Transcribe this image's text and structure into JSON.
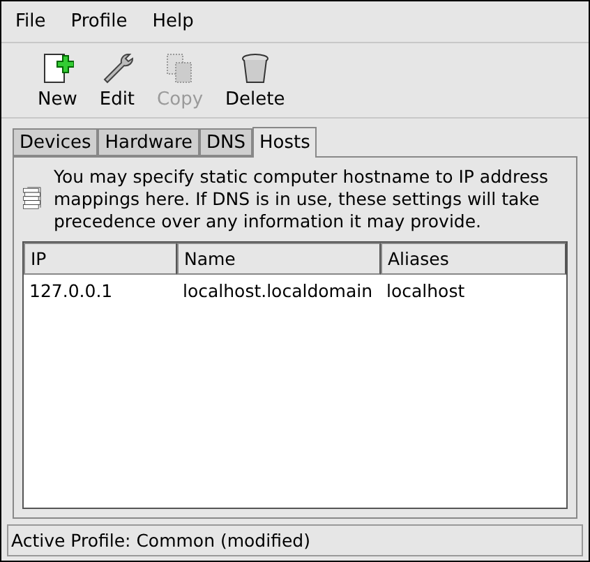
{
  "menu": [
    "File",
    "Profile",
    "Help"
  ],
  "toolbar": [
    {
      "label": "New",
      "kind": "new",
      "disabled": false
    },
    {
      "label": "Edit",
      "kind": "edit",
      "disabled": false
    },
    {
      "label": "Copy",
      "kind": "copy",
      "disabled": true
    },
    {
      "label": "Delete",
      "kind": "delete",
      "disabled": false
    }
  ],
  "tabs": [
    {
      "label": "Devices",
      "selected": false
    },
    {
      "label": "Hardware",
      "selected": false
    },
    {
      "label": "DNS",
      "selected": false
    },
    {
      "label": "Hosts",
      "selected": true
    }
  ],
  "description": "You may specify static computer hostname to IP address mappings here.  If DNS is in use, these settings will take precedence over any information it may provide.",
  "table": {
    "columns": [
      "IP",
      "Name",
      "Aliases"
    ],
    "rows": [
      [
        "127.0.0.1",
        "localhost.localdomain",
        "localhost"
      ]
    ]
  },
  "status_bar": "Active Profile: Common (modified)"
}
